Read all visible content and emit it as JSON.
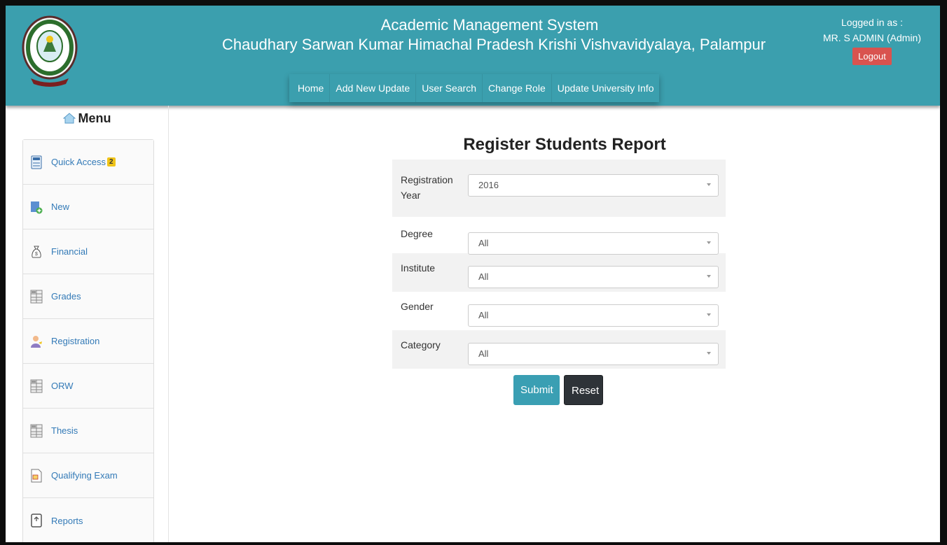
{
  "header": {
    "title_line1": "Academic Management System",
    "title_line2": "Chaudhary Sarwan Kumar Himachal Pradesh Krishi Vishvavidyalaya, Palampur",
    "nav": [
      "Home",
      "Add New Update",
      "User Search",
      "Change Role",
      "Update University Info"
    ],
    "logged_in_label": "Logged in as :",
    "user": "MR. S ADMIN (Admin)",
    "logout": "Logout",
    "accent_color": "#3b9fae"
  },
  "sidebar": {
    "menu_title": "Menu",
    "items": [
      {
        "label": "Quick Access",
        "icon": "calculator-icon",
        "badge": "2"
      },
      {
        "label": "New",
        "icon": "new-document-icon"
      },
      {
        "label": "Financial",
        "icon": "money-bag-icon"
      },
      {
        "label": "Grades",
        "icon": "grid-icon"
      },
      {
        "label": "Registration",
        "icon": "user-icon"
      },
      {
        "label": "ORW",
        "icon": "grid-icon"
      },
      {
        "label": "Thesis",
        "icon": "grid-icon"
      },
      {
        "label": "Qualifying Exam",
        "icon": "document-icon"
      },
      {
        "label": "Reports",
        "icon": "report-icon"
      }
    ]
  },
  "main": {
    "title": "Register Students Report",
    "fields": [
      {
        "label": "Registration Year",
        "value": "2016"
      },
      {
        "label": "Degree",
        "value": "All"
      },
      {
        "label": "Institute",
        "value": "All"
      },
      {
        "label": "Gender",
        "value": "All"
      },
      {
        "label": "Category",
        "value": "All"
      }
    ],
    "submit": "Submit",
    "reset": "Reset"
  }
}
